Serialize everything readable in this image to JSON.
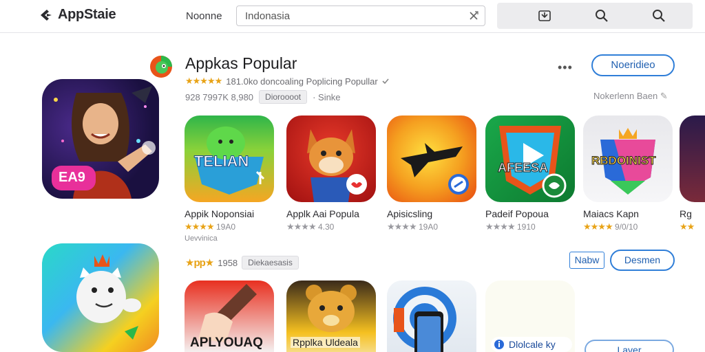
{
  "header": {
    "app_title": "AppStaie",
    "nav_home": "Noonne",
    "search_value": "Indonasia"
  },
  "section1": {
    "title": "Appkas Popular",
    "stars": "★★★★★",
    "rating_text": "181.0ko doncoaling Poplicing Popullar",
    "meta_count": "928 7997K 8,980",
    "chip": "Dioroooot",
    "meta_extra": "· Sinke",
    "primary_button": "Noeridieo",
    "side_note": "Nokerlenn Baen",
    "feature_badge": "EA9",
    "apps": [
      {
        "name": "Appik Noponsiai",
        "stars": "★★★★",
        "rating": "19A0",
        "sub": "Uevvinica",
        "icon_text": "TELIAN"
      },
      {
        "name": "Applk Aai Popula",
        "stars": "★★★★",
        "rating": "4.30",
        "icon_text": ""
      },
      {
        "name": "Apisicsling",
        "stars": "★★★★",
        "rating": "19A0",
        "icon_text": ""
      },
      {
        "name": "Padeif Popoua",
        "stars": "★★★★",
        "rating": "1910",
        "icon_text": "AFEESA"
      },
      {
        "name": "Maiacs Kapn",
        "stars": "★★★★",
        "rating": "9/0/10",
        "icon_text": "RBDOINIST"
      },
      {
        "name": "Rg",
        "stars": "★★",
        "rating": ""
      }
    ]
  },
  "section2": {
    "stars": "★pp★",
    "rating_text": "1958",
    "chip": "Diekaesasis",
    "button_small": "Nabw",
    "button_pill": "Desmen",
    "bottom_button": "Laver",
    "apps": [
      {
        "name": "APLYOUAQ",
        "icon_text": "APLYOUAQ"
      },
      {
        "name": "Rpplka Uldeala",
        "icon_text": ""
      },
      {
        "name": "",
        "icon_text": ""
      },
      {
        "name": "Dlolcale ky",
        "icon_text": ""
      }
    ]
  },
  "colors": {
    "accent": "#2f7ed8",
    "star": "#e8a317",
    "toolbar_bg": "#ececee"
  }
}
